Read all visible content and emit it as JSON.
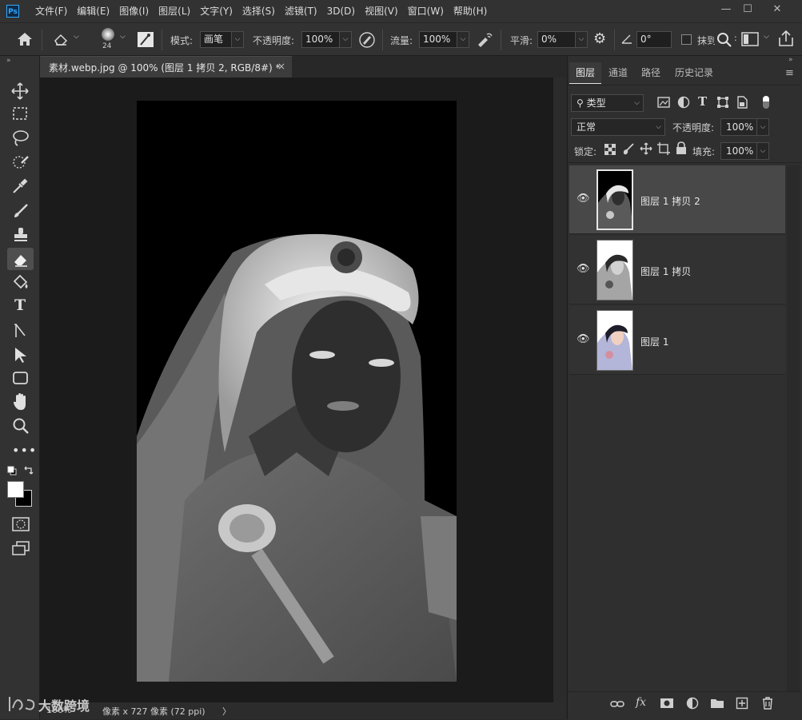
{
  "app": {
    "logo_text": "Ps"
  },
  "menu": [
    "文件(F)",
    "编辑(E)",
    "图像(I)",
    "图层(L)",
    "文字(Y)",
    "选择(S)",
    "滤镜(T)",
    "3D(D)",
    "视图(V)",
    "窗口(W)",
    "帮助(H)"
  ],
  "window_controls": {
    "minimize": "—",
    "maximize": "☐",
    "close": "✕"
  },
  "options": {
    "brush_size": "24",
    "mode_label": "模式:",
    "mode_value": "画笔",
    "opacity_label": "不透明度:",
    "opacity_value": "100%",
    "flow_label": "流量:",
    "flow_value": "100%",
    "smoothing_label": "平滑:",
    "smoothing_value": "0%",
    "angle_value": "0°",
    "erase_history_label": "抹到"
  },
  "document": {
    "tab_title": "素材.webp.jpg @ 100% (图层 1 拷贝 2, RGB/8#) *",
    "close": "×",
    "status_zoom": "100%",
    "status_info": "像素 x 727 像素 (72 ppi)",
    "status_arrow": "〉"
  },
  "watermark": "大数跨境",
  "panel": {
    "tabs": [
      "图层",
      "通道",
      "路径",
      "历史记录"
    ],
    "filter_kind": "类型",
    "blend_mode": "正常",
    "opacity_label": "不透明度:",
    "opacity_value": "100%",
    "lock_label": "锁定:",
    "fill_label": "填充:",
    "fill_value": "100%",
    "layers": [
      {
        "name": "图层 1 拷贝 2",
        "selected": true,
        "style": "inverted"
      },
      {
        "name": "图层 1 拷贝",
        "selected": false,
        "style": "grayscale"
      },
      {
        "name": "图层 1",
        "selected": false,
        "style": "color"
      }
    ]
  },
  "colors": {
    "accent": "#31a8ff",
    "foreground_swatch": "#ffffff",
    "background_swatch": "#000000"
  }
}
